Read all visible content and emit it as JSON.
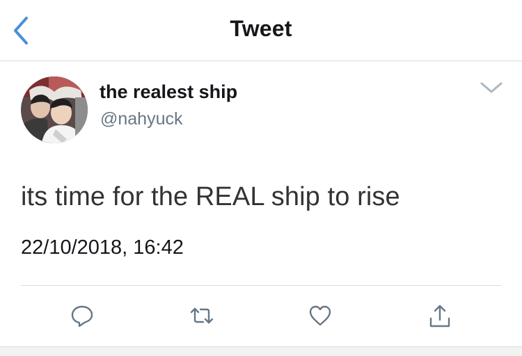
{
  "nav": {
    "title": "Tweet"
  },
  "tweet": {
    "display_name": "the realest ship",
    "handle": "@nahyuck",
    "text": "its time for the REAL ship to rise",
    "timestamp": "22/10/2018, 16:42"
  },
  "actions": [
    {
      "icon": "reply-icon"
    },
    {
      "icon": "retweet-icon"
    },
    {
      "icon": "like-icon"
    },
    {
      "icon": "share-icon"
    }
  ],
  "colors": {
    "accent": "#4a90d9",
    "icon": "#657786",
    "text": "#14171a",
    "secondary": "#657786"
  }
}
